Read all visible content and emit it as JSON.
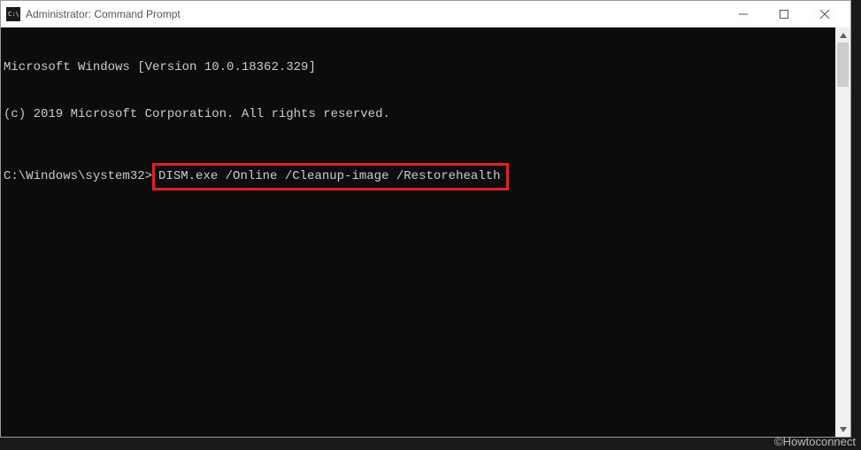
{
  "window": {
    "title": "Administrator: Command Prompt"
  },
  "terminal": {
    "line1": "Microsoft Windows [Version 10.0.18362.329]",
    "line2": "(c) 2019 Microsoft Corporation. All rights reserved.",
    "prompt": "C:\\Windows\\system32>",
    "command": "DISM.exe /Online /Cleanup-image /Restorehealth"
  },
  "watermark": "©Howtoconnect"
}
